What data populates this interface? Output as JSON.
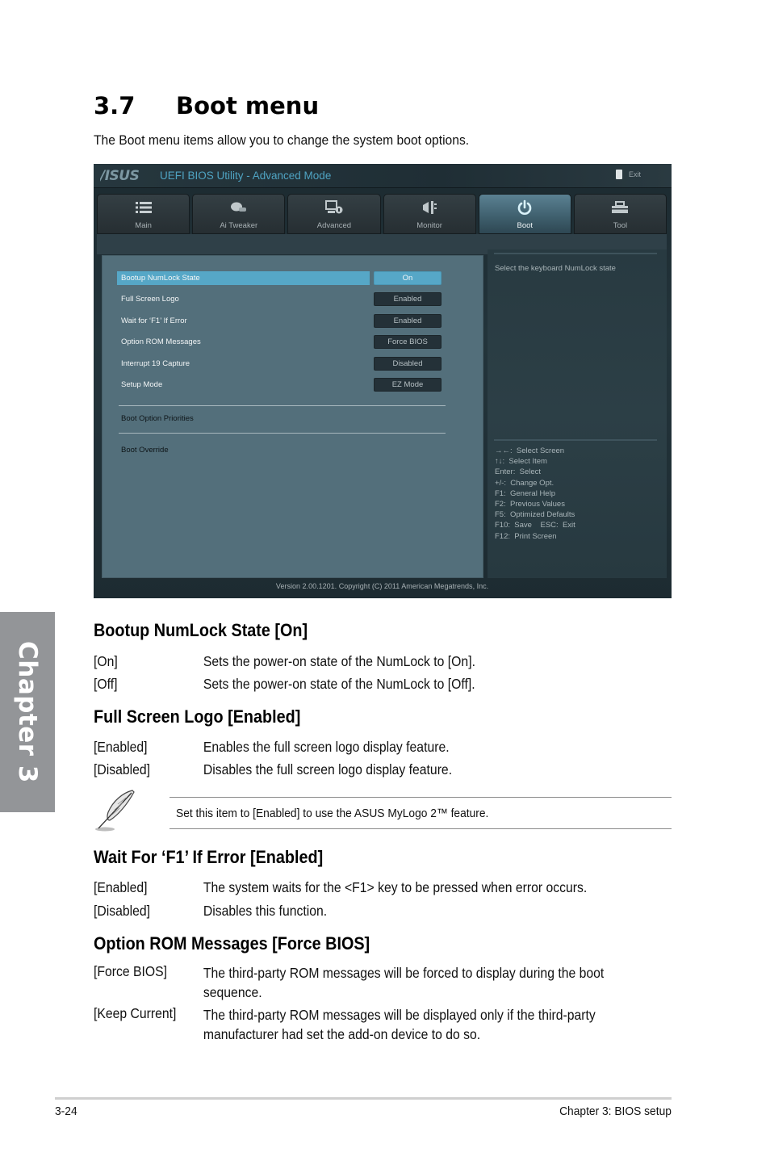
{
  "chapter_tab": "Chapter 3",
  "section": {
    "number": "3.7",
    "title": "Boot menu",
    "intro": "The Boot menu items allow you to change the system boot options."
  },
  "bios": {
    "logo": "/ISUS",
    "title": "UEFI BIOS Utility - Advanced Mode",
    "exit_label": "Exit",
    "tabs": [
      {
        "label": "Main",
        "icon": "list-icon"
      },
      {
        "label": "Ai  Tweaker",
        "icon": "tweaker-icon"
      },
      {
        "label": "Advanced",
        "icon": "advanced-icon"
      },
      {
        "label": "Monitor",
        "icon": "monitor-icon"
      },
      {
        "label": "Boot",
        "icon": "power-icon",
        "active": true
      },
      {
        "label": "Tool",
        "icon": "toolbox-icon"
      }
    ],
    "items": [
      {
        "label": "Bootup NumLock State",
        "value": "On",
        "selected": true
      },
      {
        "label": "Full Screen Logo",
        "value": "Enabled"
      },
      {
        "label": "Wait for ‘F1’ If Error",
        "value": "Enabled"
      },
      {
        "label": "Option ROM Messages",
        "value": "Force BIOS"
      },
      {
        "label": "Interrupt 19 Capture",
        "value": "Disabled"
      },
      {
        "label": "Setup Mode",
        "value": "EZ Mode"
      }
    ],
    "submenus": [
      "Boot Option Priorities",
      "Boot Override"
    ],
    "help_text": "Select the keyboard NumLock state",
    "keys": [
      "→←:  Select Screen",
      "↑↓:  Select Item",
      "Enter:  Select",
      "+/-:  Change Opt.",
      "F1:  General Help",
      "F2:  Previous Values",
      "F5:  Optimized Defaults",
      "F10:  Save    ESC:  Exit",
      "F12:  Print Screen"
    ],
    "footer": "Version  2.00.1201.  Copyright  (C)  2011  American  Megatrends,  Inc.",
    "colors": {
      "accent": "#56a7c7",
      "panel": "#536f7b",
      "title": "#4fa3c2"
    }
  },
  "sections": [
    {
      "heading": "Bootup NumLock State [On]",
      "options": [
        {
          "key": "[On]",
          "desc": "Sets the power-on state of the NumLock to [On]."
        },
        {
          "key": "[Off]",
          "desc": "Sets the power-on state of the NumLock to [Off]."
        }
      ]
    },
    {
      "heading": "Full Screen Logo [Enabled]",
      "options": [
        {
          "key": "[Enabled]",
          "desc": "Enables the full screen logo display feature."
        },
        {
          "key": "[Disabled]",
          "desc": "Disables the full screen logo display feature."
        }
      ]
    },
    {
      "heading": "Wait For ‘F1’ If Error [Enabled]",
      "options": [
        {
          "key": "[Enabled]",
          "desc": "The system waits for the <F1> key to be pressed when error occurs."
        },
        {
          "key": "[Disabled]",
          "desc": "Disables this function."
        }
      ]
    },
    {
      "heading": "Option ROM Messages [Force BIOS]",
      "options": [
        {
          "key": "[Force BIOS]",
          "desc": "The third-party ROM messages will be forced to display during the boot sequence."
        },
        {
          "key": "[Keep Current]",
          "desc": "The third-party ROM messages will be displayed only if the third-party manufacturer had set the add-on device to do so."
        }
      ]
    }
  ],
  "note": {
    "icon": "feather-pen-icon",
    "text": "Set this item to [Enabled] to use the ASUS MyLogo 2™ feature."
  },
  "footer": {
    "page": "3-24",
    "chapter": "Chapter 3: BIOS setup"
  }
}
